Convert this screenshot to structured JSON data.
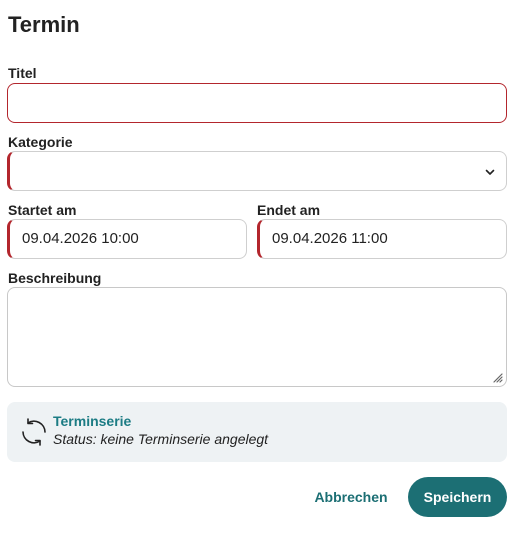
{
  "dialog": {
    "title": "Termin"
  },
  "form": {
    "title_label": "Titel",
    "title_value": "",
    "category_label": "Kategorie",
    "category_value": "",
    "start_label": "Startet am",
    "start_value": "09.04.2026 10:00",
    "end_label": "Endet am",
    "end_value": "09.04.2026 11:00",
    "description_label": "Beschreibung",
    "description_value": ""
  },
  "series": {
    "icon": "sync-icon",
    "link_label": "Terminserie",
    "status": "Status: keine Terminserie angelegt"
  },
  "actions": {
    "cancel_label": "Abbrechen",
    "save_label": "Speichern"
  },
  "colors": {
    "accent": "#1c6f74",
    "link": "#1c7c84",
    "error": "#b3262d",
    "panel_bg": "#eef2f4"
  }
}
